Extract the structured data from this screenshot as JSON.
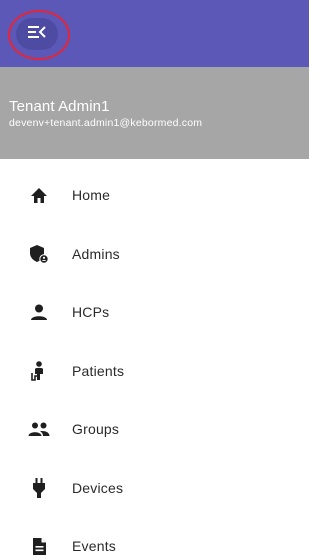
{
  "header": {
    "menu_icon": "menu-open-icon",
    "bar_color": "#5b58b8",
    "annotation_color": "#e3263a"
  },
  "profile": {
    "name": "Tenant Admin1",
    "email": "devenv+tenant.admin1@kebormed.com",
    "background_color": "#a6a6a6"
  },
  "nav": {
    "items": [
      {
        "label": "Home",
        "icon": "home-icon"
      },
      {
        "label": "Admins",
        "icon": "admin-shield-icon"
      },
      {
        "label": "HCPs",
        "icon": "person-icon"
      },
      {
        "label": "Patients",
        "icon": "patient-icon"
      },
      {
        "label": "Groups",
        "icon": "group-icon"
      },
      {
        "label": "Devices",
        "icon": "plug-icon"
      },
      {
        "label": "Events",
        "icon": "document-icon"
      }
    ]
  }
}
